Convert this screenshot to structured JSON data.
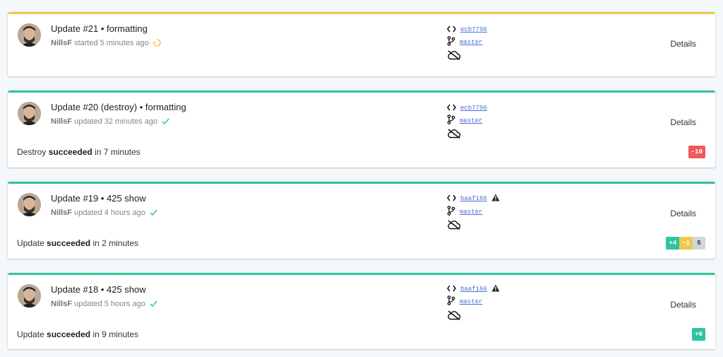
{
  "colors": {
    "in_progress": "#f0c94a",
    "success": "#2ec4a0",
    "badge_delete": "#ef5a5a",
    "badge_create": "#2ec4a0",
    "badge_update": "#efc94d",
    "badge_same": "#cfd6dc"
  },
  "updates": [
    {
      "title": "Update #21 • formatting",
      "user": "NillsF",
      "action": "started",
      "time": "5 minutes ago",
      "status": "in-progress",
      "status_icon": "spinner-icon",
      "commit": "ecb7796",
      "commit_warning": false,
      "branch": "master",
      "details_label": "Details",
      "summary": null,
      "badges": []
    },
    {
      "title": "Update #20 (destroy) • formatting",
      "user": "NillsF",
      "action": "updated",
      "time": "32 minutes ago",
      "status": "succeeded",
      "status_icon": "check-icon",
      "commit": "ecb7796",
      "commit_warning": false,
      "branch": "master",
      "details_label": "Details",
      "summary": {
        "prefix": "Destroy",
        "result": "succeeded",
        "suffix": "in 7 minutes"
      },
      "badges": [
        {
          "label": "-10",
          "kind": "delete"
        }
      ]
    },
    {
      "title": "Update #19 • 425 show",
      "user": "NillsF",
      "action": "updated",
      "time": "4 hours ago",
      "status": "succeeded",
      "status_icon": "check-icon",
      "commit": "baaf166",
      "commit_warning": true,
      "branch": "master",
      "details_label": "Details",
      "summary": {
        "prefix": "Update",
        "result": "succeeded",
        "suffix": "in 2 minutes"
      },
      "badges": [
        {
          "label": "+4",
          "kind": "create"
        },
        {
          "label": "~1",
          "kind": "update"
        },
        {
          "label": "5",
          "kind": "same"
        }
      ]
    },
    {
      "title": "Update #18 • 425 show",
      "user": "NillsF",
      "action": "updated",
      "time": "5 hours ago",
      "status": "succeeded",
      "status_icon": "check-icon",
      "commit": "baaf166",
      "commit_warning": true,
      "branch": "master",
      "details_label": "Details",
      "summary": {
        "prefix": "Update",
        "result": "succeeded",
        "suffix": "in 9 minutes"
      },
      "badges": [
        {
          "label": "+6",
          "kind": "create"
        }
      ]
    }
  ]
}
